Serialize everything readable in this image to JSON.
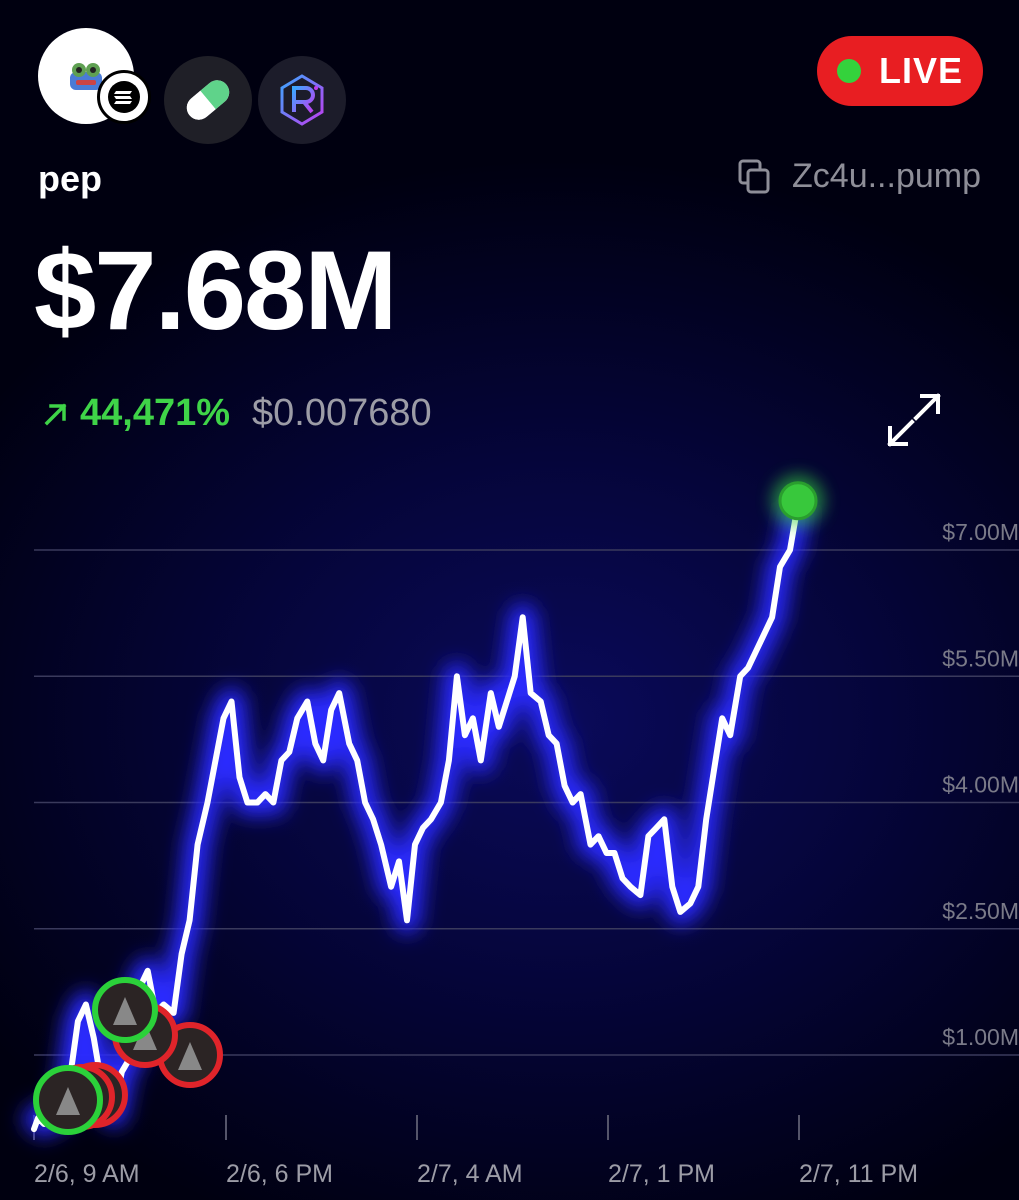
{
  "token": {
    "name": "pep",
    "address_short": "Zc4u...pump",
    "market_cap": "$7.68M",
    "change_pct": "44,471%",
    "price": "$0.007680"
  },
  "live": {
    "label": "LIVE",
    "color": "#e81e22",
    "dot_color": "#34d23c"
  },
  "icons": {
    "avatar": "frog-avatar-icon",
    "chain": "solana-icon",
    "platform_1": "pill-icon",
    "platform_2": "raydium-icon",
    "copy": "copy-icon",
    "change": "arrow-up-right-icon",
    "expand": "expand-icon"
  },
  "colors": {
    "positive": "#3fd448",
    "line": "#ffffff",
    "glow": "#2a2aff",
    "trade_buy": "#2bd13a",
    "trade_sell": "#e0242a"
  },
  "chart_data": {
    "type": "line",
    "x_tick_labels": [
      "2/6, 9 AM",
      "2/6, 6 PM",
      "2/7, 4 AM",
      "2/7, 1 PM",
      "2/7, 11 PM"
    ],
    "y_tick_labels": [
      "$7.00M",
      "$5.50M",
      "$4.00M",
      "$2.50M",
      "$1.00M"
    ],
    "y_ticks": [
      7.0,
      5.5,
      4.0,
      2.5,
      1.0
    ],
    "ylim": [
      0.0,
      7.0
    ],
    "y_unit": "$M",
    "grid": true,
    "series": [
      {
        "x_hours": [
          0,
          0.2,
          0.5,
          0.9,
          1.3,
          1.7,
          2.2,
          2.6,
          3.0,
          3.5,
          4.0,
          4.4,
          4.9,
          5.3,
          5.7,
          6.1,
          6.5,
          7.0,
          7.4,
          7.8,
          8.2,
          8.7,
          9.1,
          9.5,
          9.9,
          10.3,
          10.7,
          11.2,
          11.6,
          12.0,
          12.4,
          12.8,
          13.2,
          13.7,
          14.1,
          14.5,
          14.9,
          15.3,
          15.8,
          16.2,
          16.6,
          17.0,
          17.4,
          17.9,
          18.3,
          18.7,
          19.1,
          19.5,
          19.9,
          20.4,
          20.8,
          21.2,
          21.6,
          22.0,
          22.4,
          22.9,
          23.3,
          23.7,
          24.1,
          24.5,
          24.9,
          25.4,
          25.8,
          26.2,
          26.6,
          27.0,
          27.4,
          27.9,
          28.3,
          28.7,
          29.1,
          29.5,
          29.9,
          30.4,
          30.8,
          31.2,
          31.6,
          32.0,
          32.4,
          32.9,
          33.3,
          33.7,
          34.1,
          34.5,
          34.9,
          35.4,
          35.8,
          36.2,
          36.6,
          37.0,
          37.4,
          37.9,
          38.3
        ],
        "values": [
          0.12,
          0.25,
          0.18,
          0.32,
          0.28,
          0.55,
          1.4,
          1.6,
          1.2,
          0.5,
          0.3,
          0.8,
          1.0,
          1.8,
          2.0,
          1.5,
          1.6,
          1.5,
          2.2,
          2.6,
          3.5,
          4.0,
          4.5,
          5.0,
          5.2,
          4.3,
          4.0,
          4.0,
          4.1,
          4.0,
          4.5,
          4.6,
          5.0,
          5.2,
          4.7,
          4.5,
          5.1,
          5.3,
          4.7,
          4.5,
          4.0,
          3.8,
          3.5,
          3.0,
          3.3,
          2.6,
          3.5,
          3.7,
          3.8,
          4.0,
          4.5,
          5.5,
          4.8,
          5.0,
          4.5,
          5.3,
          4.9,
          5.2,
          5.5,
          6.2,
          5.3,
          5.2,
          4.8,
          4.7,
          4.2,
          4.0,
          4.1,
          3.5,
          3.6,
          3.4,
          3.4,
          3.1,
          3.0,
          2.9,
          3.6,
          3.7,
          3.8,
          3.0,
          2.7,
          2.8,
          3.0,
          3.8,
          4.4,
          5.0,
          4.8,
          5.5,
          5.6,
          5.8,
          6.0,
          6.2,
          6.8,
          7.0,
          7.55
        ]
      }
    ],
    "current_value": 7.68
  }
}
